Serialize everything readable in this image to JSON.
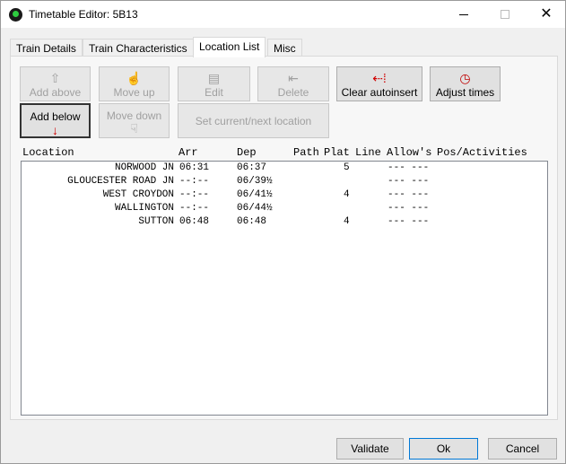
{
  "window": {
    "title": "Timetable Editor: 5B13"
  },
  "tabs": [
    {
      "label": "Train Details",
      "active": false
    },
    {
      "label": "Train Characteristics",
      "active": false
    },
    {
      "label": "Location List",
      "active": true
    },
    {
      "label": "Misc",
      "active": false
    }
  ],
  "toolbar": {
    "add_above": "Add above",
    "move_up": "Move up",
    "edit": "Edit",
    "delete": "Delete",
    "clear_autoinsert": "Clear autoinsert",
    "adjust_times": "Adjust times",
    "add_below": "Add below",
    "move_down": "Move down",
    "set_current_next": "Set current/next location"
  },
  "list": {
    "headers": {
      "location": "Location",
      "arr": "Arr",
      "dep": "Dep",
      "path": "Path",
      "plat": "Plat",
      "line": "Line",
      "allows": "Allow's",
      "pos": "Pos/Activities"
    },
    "rows": [
      {
        "location": "NORWOOD JN",
        "arr": "06:31",
        "dep": "06:37",
        "plat": "5",
        "allows": "--- ---"
      },
      {
        "location": "GLOUCESTER ROAD JN",
        "arr": "--:--",
        "dep": "06/39½",
        "plat": "",
        "allows": "--- ---"
      },
      {
        "location": "WEST CROYDON",
        "arr": "--:--",
        "dep": "06/41½",
        "plat": "4",
        "allows": "--- ---"
      },
      {
        "location": "WALLINGTON",
        "arr": "--:--",
        "dep": "06/44½",
        "plat": "",
        "allows": "--- ---"
      },
      {
        "location": "SUTTON",
        "arr": "06:48",
        "dep": "06:48",
        "plat": "4",
        "allows": "--- ---"
      }
    ]
  },
  "footer": {
    "validate": "Validate",
    "ok": "Ok",
    "cancel": "Cancel"
  }
}
